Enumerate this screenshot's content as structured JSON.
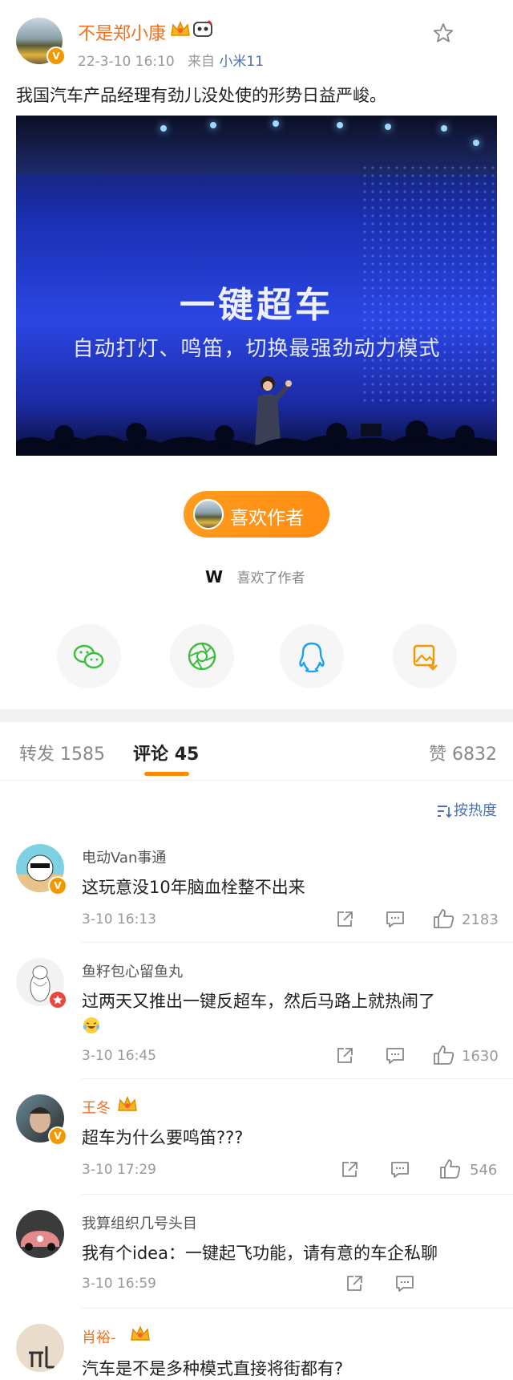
{
  "post": {
    "author": "不是郑小康",
    "time": "22-3-10 16:10",
    "source_prefix": "来自",
    "source": "小米11",
    "text": "我国汽车产品经理有劲儿没处使的形势日益严峻。",
    "image": {
      "title": "一键超车",
      "subtitle": "自动打灯、鸣笛，切换最强劲动力模式"
    },
    "like_author_label": "喜欢作者",
    "liked_by_initial": "W",
    "liked_by_text": "喜欢了作者"
  },
  "share": [
    "wechat-icon",
    "moments-icon",
    "qq-icon",
    "save-image-icon"
  ],
  "tabs": {
    "repost_label": "转发",
    "repost_count": "1585",
    "comment_label": "评论",
    "comment_count": "45",
    "like_label": "赞",
    "like_count": "6832"
  },
  "sort_label": "按热度",
  "comments": [
    {
      "name": "电动Van事通",
      "text": "这玩意没10年脑血栓整不出来",
      "time": "3-10 16:13",
      "likes": "2183"
    },
    {
      "name": "鱼籽包心留鱼丸",
      "text": "过两天又推出一键反超车，然后马路上就热闹了",
      "time": "3-10 16:45",
      "likes": "1630"
    },
    {
      "name": "王冬",
      "text": "超车为什么要鸣笛???",
      "time": "3-10 17:29",
      "likes": "546"
    },
    {
      "name": "我算组织几号头目",
      "text": "我有个idea：一键起飞功能，请有意的车企私聊",
      "time": "3-10 16:59",
      "likes": ""
    },
    {
      "name": "肖裕-",
      "text": "汽车是不是多种模式直接将街都有?",
      "time": "",
      "likes": ""
    }
  ],
  "colors": {
    "accent": "#f0721f",
    "button": "#ff9419",
    "link": "#4a72b2"
  }
}
